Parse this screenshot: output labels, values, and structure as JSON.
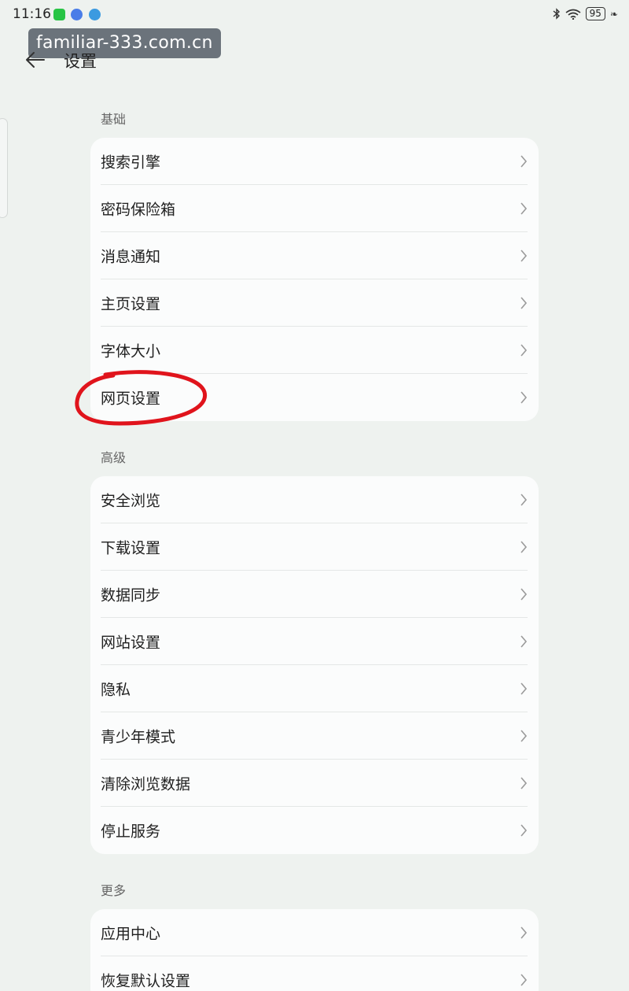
{
  "status_bar": {
    "time": "11:16",
    "battery": "95",
    "apps": [
      "wechat-icon",
      "music-icon",
      "browser-icon"
    ]
  },
  "watermark": "familiar-333.com.cn",
  "header": {
    "back_icon": "arrow-left-icon",
    "title": "设置"
  },
  "sections": [
    {
      "label": "基础",
      "items": [
        "搜索引擎",
        "密码保险箱",
        "消息通知",
        "主页设置",
        "字体大小",
        "网页设置"
      ]
    },
    {
      "label": "高级",
      "items": [
        "安全浏览",
        "下载设置",
        "数据同步",
        "网站设置",
        "隐私",
        "青少年模式",
        "清除浏览数据",
        "停止服务"
      ]
    },
    {
      "label": "更多",
      "items": [
        "应用中心",
        "恢复默认设置"
      ]
    }
  ],
  "highlighted_item": "网页设置",
  "colors": {
    "background": "#eef2ef",
    "card": "#fbfcfc",
    "annotation": "#e0141c"
  }
}
